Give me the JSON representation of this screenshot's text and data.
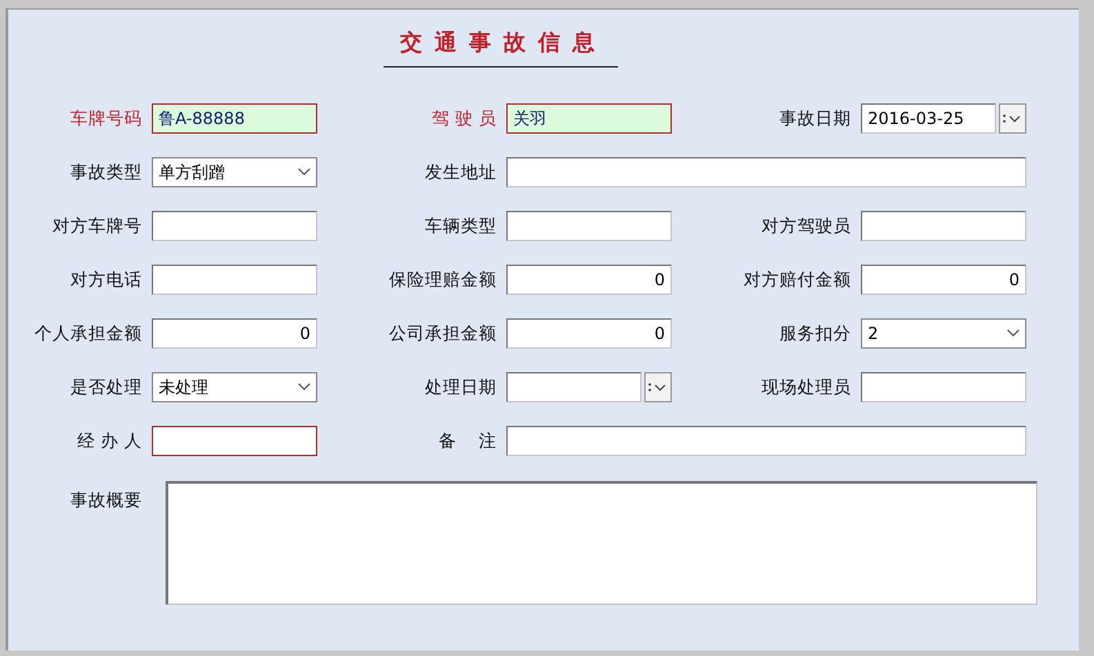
{
  "title": "交通事故信息",
  "rows": [
    {
      "fields": [
        {
          "label": "车牌号码",
          "required": true,
          "kind": "text",
          "value": "鲁A-88888",
          "highlighted": true,
          "error": true
        },
        {
          "label": "驾 驶 员",
          "required": true,
          "kind": "text",
          "value": "关羽",
          "highlighted": true,
          "error": true
        },
        {
          "label": "事故日期",
          "required": false,
          "kind": "date",
          "value": "2016-03-25",
          "highlighted": false,
          "error": false
        }
      ]
    },
    {
      "fields": [
        {
          "label": "事故类型",
          "required": false,
          "kind": "select",
          "value": "单方刮蹭",
          "highlighted": false,
          "error": false
        },
        {
          "label": "发生地址",
          "required": false,
          "kind": "wide",
          "highlighted": false,
          "error": false
        }
      ]
    },
    {
      "fields": [
        {
          "label": "对方车牌号",
          "required": false,
          "kind": "text",
          "highlighted": false,
          "error": false
        },
        {
          "label": "车辆类型",
          "required": false,
          "kind": "text",
          "highlighted": false,
          "error": false
        },
        {
          "label": "对方驾驶员",
          "required": false,
          "kind": "text",
          "highlighted": false,
          "error": false
        }
      ]
    },
    {
      "fields": [
        {
          "label": "对方电话",
          "required": false,
          "kind": "text",
          "highlighted": false,
          "error": false
        },
        {
          "label": "保险理赔金额",
          "required": false,
          "kind": "number",
          "value": "0",
          "highlighted": false,
          "error": false
        },
        {
          "label": "对方赔付金额",
          "required": false,
          "kind": "number",
          "value": "0",
          "highlighted": false,
          "error": false
        }
      ]
    },
    {
      "fields": [
        {
          "label": "个人承担金额",
          "required": false,
          "kind": "number",
          "value": "0",
          "highlighted": false,
          "error": false
        },
        {
          "label": "公司承担金额",
          "required": false,
          "kind": "number",
          "value": "0",
          "highlighted": false,
          "error": false
        },
        {
          "label": "服务扣分",
          "required": false,
          "kind": "select",
          "value": "2",
          "highlighted": false,
          "error": false
        }
      ]
    },
    {
      "fields": [
        {
          "label": "是否处理",
          "required": false,
          "kind": "select",
          "value": "未处理",
          "highlighted": false,
          "error": false
        },
        {
          "label": "处理日期",
          "required": false,
          "kind": "date",
          "highlighted": false,
          "error": false
        },
        {
          "label": "现场处理员",
          "required": false,
          "kind": "text",
          "highlighted": false,
          "error": false
        }
      ]
    },
    {
      "fields": [
        {
          "label": "经 办 人",
          "required": false,
          "kind": "text",
          "highlighted": false,
          "error": true
        },
        {
          "label": "备    注",
          "required": false,
          "kind": "wide",
          "highlighted": false,
          "error": false
        }
      ]
    }
  ],
  "summary": {
    "label": "事故概要"
  }
}
